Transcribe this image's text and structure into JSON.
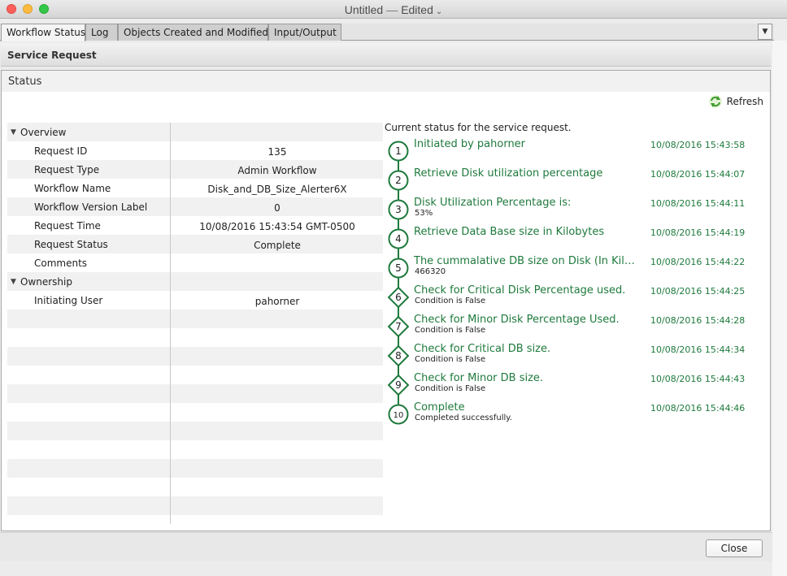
{
  "window": {
    "title": "Untitled",
    "separator": "—",
    "state": "Edited"
  },
  "tabs": [
    {
      "label": "Workflow Status",
      "active": true
    },
    {
      "label": "Log"
    },
    {
      "label": "Objects Created and Modified"
    },
    {
      "label": "Input/Output"
    }
  ],
  "service_request": {
    "header": "Service Request"
  },
  "status": {
    "title": "Status",
    "refresh_label": "Refresh"
  },
  "properties": {
    "overview_label": "Overview",
    "ownership_label": "Ownership",
    "rows": [
      {
        "name": "Request ID",
        "value": "135"
      },
      {
        "name": "Request Type",
        "value": "Admin Workflow"
      },
      {
        "name": "Workflow Name",
        "value": "Disk_and_DB_Size_Alerter6X"
      },
      {
        "name": "Workflow Version Label",
        "value": "0"
      },
      {
        "name": "Request Time",
        "value": "10/08/2016 15:43:54 GMT-0500"
      },
      {
        "name": "Request Status",
        "value": "Complete"
      },
      {
        "name": "Comments",
        "value": ""
      }
    ],
    "ownership_rows": [
      {
        "name": "Initiating User",
        "value": "pahorner"
      }
    ]
  },
  "timeline": {
    "heading": "Current status for the service request.",
    "steps": [
      {
        "num": "1",
        "shape": "circle",
        "title": "Initiated by pahorner",
        "sub": "",
        "time": "10/08/2016 15:43:58"
      },
      {
        "num": "2",
        "shape": "circle",
        "title": "Retrieve Disk utilization percentage",
        "sub": "",
        "time": "10/08/2016 15:44:07"
      },
      {
        "num": "3",
        "shape": "circle",
        "title": "Disk Utilization Percentage is:",
        "sub": "53%",
        "time": "10/08/2016 15:44:11"
      },
      {
        "num": "4",
        "shape": "circle",
        "title": "Retrieve Data Base size in Kilobytes",
        "sub": "",
        "time": "10/08/2016 15:44:19"
      },
      {
        "num": "5",
        "shape": "circle",
        "title": "The cummalative DB size on Disk (In Kilobytes)",
        "sub": "466320",
        "time": "10/08/2016 15:44:22"
      },
      {
        "num": "6",
        "shape": "diamond",
        "title": "Check for Critical Disk Percentage used.",
        "sub": "Condition is False",
        "time": "10/08/2016 15:44:25"
      },
      {
        "num": "7",
        "shape": "diamond",
        "title": "Check for Minor Disk Percentage Used.",
        "sub": "Condition is False",
        "time": "10/08/2016 15:44:28"
      },
      {
        "num": "8",
        "shape": "diamond",
        "title": "Check for Critical DB size.",
        "sub": "Condition is False",
        "time": "10/08/2016 15:44:34"
      },
      {
        "num": "9",
        "shape": "diamond",
        "title": "Check for Minor DB size.",
        "sub": "Condition is False",
        "time": "10/08/2016 15:44:43"
      },
      {
        "num": "10",
        "shape": "circle",
        "title": "Complete",
        "sub": "Completed successfully.",
        "time": "10/08/2016 15:44:46"
      }
    ]
  },
  "footer": {
    "close_label": "Close"
  },
  "colors": {
    "accent_green": "#1f7a3d"
  },
  "icons": {
    "refresh": "refresh-icon",
    "caret": "disclosure-triangle-icon",
    "tab_menu": "chevron-down-icon"
  }
}
